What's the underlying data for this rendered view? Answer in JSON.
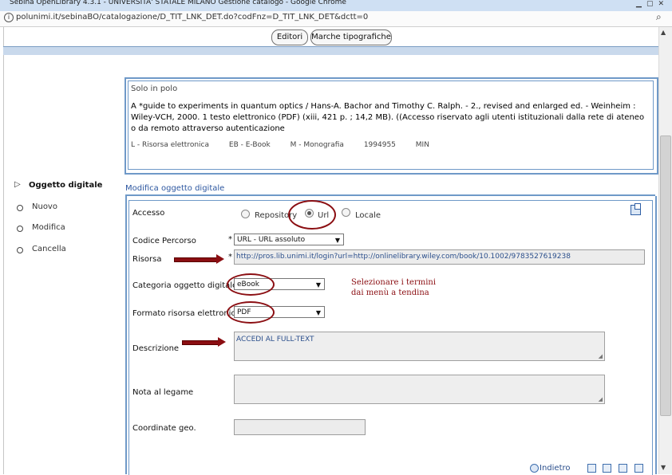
{
  "window": {
    "title": "Sebina OpenLibrary 4.3.1 - UNIVERSITA' STATALE MILANO Gestione catalogo - Google Chrome"
  },
  "address_bar": {
    "url": "polunimi.it/sebinaBO/catalogazione/D_TIT_LNK_DET.do?codFnz=D_TIT_LNK_DET&dctt=0",
    "info_icon": "info-icon",
    "search_icon": "magnifier-icon"
  },
  "tabs": [
    "Editori",
    "Marche tipografiche"
  ],
  "polo": {
    "title": "Solo in polo",
    "description": "A *guide to experiments in quantum optics / Hans-A. Bachor and Timothy C. Ralph. - 2., revised and enlarged ed. - Weinheim : Wiley-VCH, 2000. 1 testo elettronico (PDF) (xiii, 421 p. ; 14,2 MB). ((Accesso riservato agli utenti istituzionali dalla rete di ateneo o da remoto attraverso autenticazione",
    "meta": [
      "L - Risorsa elettronica",
      "EB - E-Book",
      "M - Monografia",
      "1994955",
      "MIN"
    ]
  },
  "sidebar": {
    "heading": "Oggetto digitale",
    "items": [
      {
        "label": "Nuovo"
      },
      {
        "label": "Modifica"
      },
      {
        "label": "Cancella"
      }
    ]
  },
  "form": {
    "title": "Modifica oggetto digitale",
    "accesso": {
      "label": "Accesso",
      "options": [
        {
          "label": "Repository",
          "selected": false
        },
        {
          "label": "Url",
          "selected": true
        },
        {
          "label": "Locale",
          "selected": false
        }
      ]
    },
    "codice_percorso": {
      "label": "Codice Percorso",
      "required": "*",
      "value": "URL - URL assoluto"
    },
    "risorsa": {
      "label": "Risorsa",
      "required": "*",
      "value": "http://pros.lib.unimi.it/login?url=http://onlinelibrary.wiley.com/book/10.1002/9783527619238"
    },
    "categoria": {
      "label": "Categoria oggetto digitale",
      "value": "eBook"
    },
    "formato": {
      "label": "Formato risorsa elettronica",
      "value": "PDF"
    },
    "descrizione": {
      "label": "Descrizione",
      "value": "ACCEDI AL FULL-TEXT"
    },
    "nota": {
      "label": "Nota al legame",
      "value": ""
    },
    "coordinate": {
      "label": "Coordinate geo.",
      "value": ""
    },
    "back_label": "Indietro"
  },
  "annotation": {
    "note_line1": "Selezionare i termini",
    "note_line2": "dai menù a tendina",
    "color": "#8b0e12"
  }
}
